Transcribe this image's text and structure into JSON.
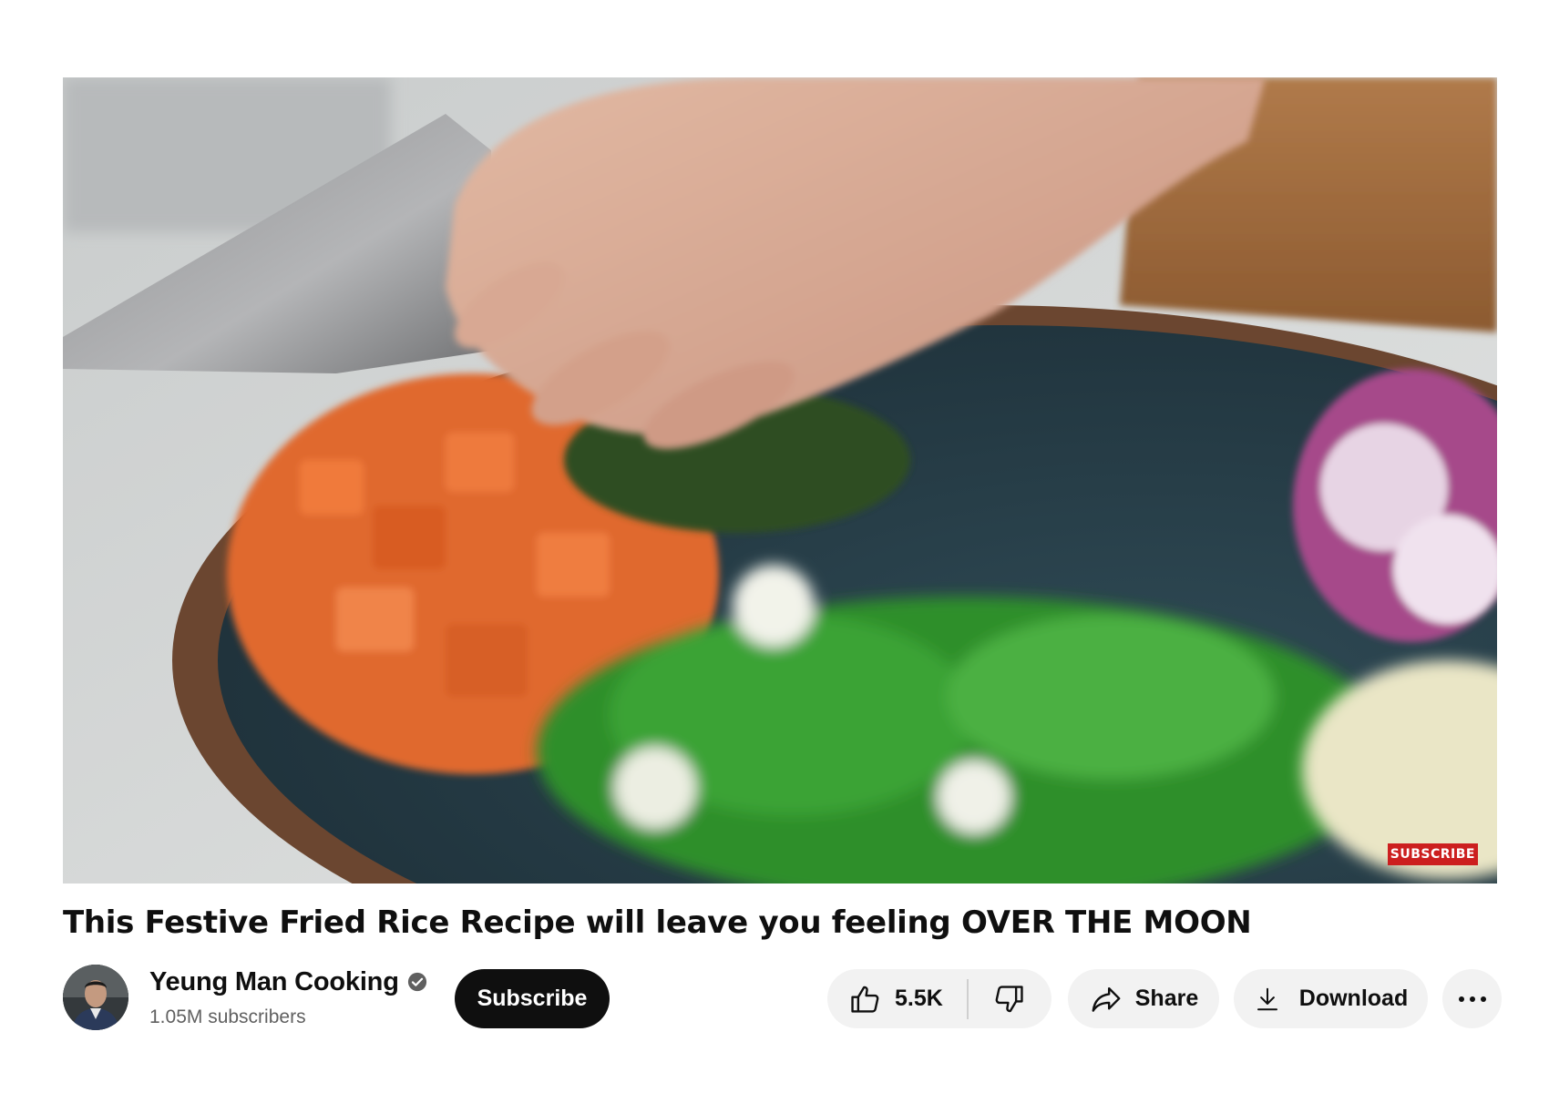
{
  "video": {
    "description_icon": "video-frame",
    "watermark_label": "SUBSCRIBE",
    "watermark_color": "#cc1f1f"
  },
  "title": "This Festive Fried Rice Recipe will leave you feeling OVER THE MOON",
  "channel": {
    "name": "Yeung Man Cooking",
    "verified": true,
    "verified_icon": "check-circle-icon",
    "subscribers": "1.05M subscribers"
  },
  "actions": {
    "subscribe_label": "Subscribe",
    "like_count": "5.5K",
    "like_icon": "thumbs-up-icon",
    "dislike_icon": "thumbs-down-icon",
    "share_label": "Share",
    "share_icon": "share-arrow-icon",
    "download_label": "Download",
    "download_icon": "download-icon",
    "more_icon": "more-horizontal-icon"
  },
  "colors": {
    "primary_text": "#0f0f0f",
    "secondary_text": "#606060",
    "pill_background": "#f2f2f2",
    "subscribe_background": "#0f0f0f"
  }
}
